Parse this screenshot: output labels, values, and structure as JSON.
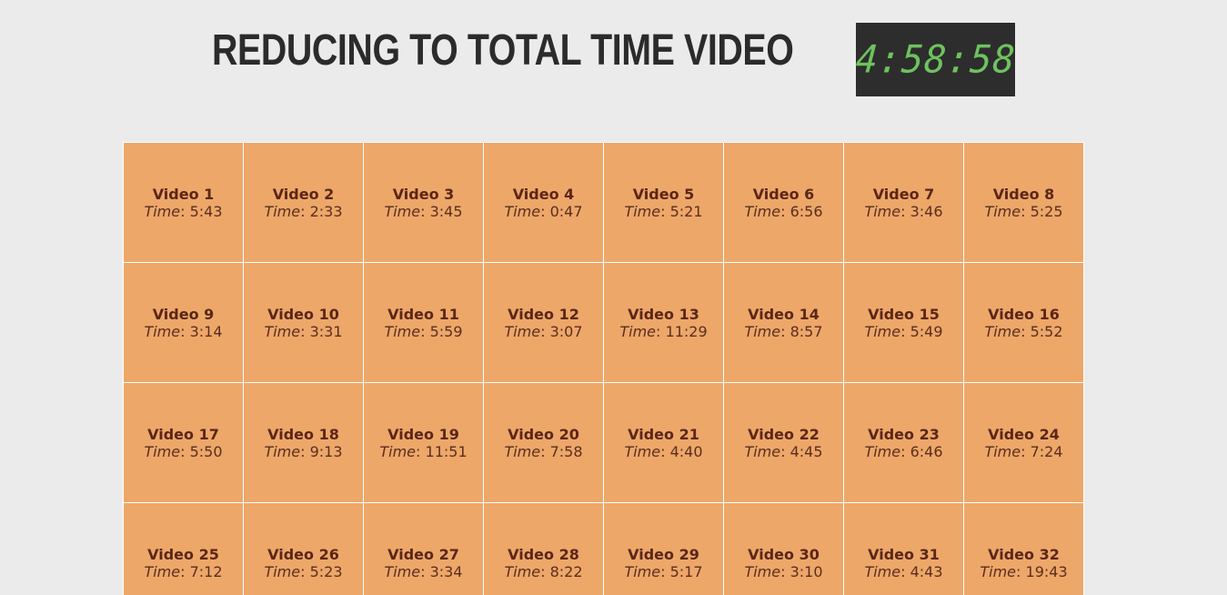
{
  "header": {
    "title": "REDUCING TO TOTAL TIME VIDEO",
    "total_time": "4:58:58"
  },
  "time_label": "Time",
  "videos": [
    {
      "name": "Video 1",
      "time": "5:43"
    },
    {
      "name": "Video 2",
      "time": "2:33"
    },
    {
      "name": "Video 3",
      "time": "3:45"
    },
    {
      "name": "Video 4",
      "time": "0:47"
    },
    {
      "name": "Video 5",
      "time": "5:21"
    },
    {
      "name": "Video 6",
      "time": "6:56"
    },
    {
      "name": "Video 7",
      "time": "3:46"
    },
    {
      "name": "Video 8",
      "time": "5:25"
    },
    {
      "name": "Video 9",
      "time": "3:14"
    },
    {
      "name": "Video 10",
      "time": "3:31"
    },
    {
      "name": "Video 11",
      "time": "5:59"
    },
    {
      "name": "Video 12",
      "time": "3:07"
    },
    {
      "name": "Video 13",
      "time": "11:29"
    },
    {
      "name": "Video 14",
      "time": "8:57"
    },
    {
      "name": "Video 15",
      "time": "5:49"
    },
    {
      "name": "Video 16",
      "time": "5:52"
    },
    {
      "name": "Video 17",
      "time": "5:50"
    },
    {
      "name": "Video 18",
      "time": "9:13"
    },
    {
      "name": "Video 19",
      "time": "11:51"
    },
    {
      "name": "Video 20",
      "time": "7:58"
    },
    {
      "name": "Video 21",
      "time": "4:40"
    },
    {
      "name": "Video 22",
      "time": "4:45"
    },
    {
      "name": "Video 23",
      "time": "6:46"
    },
    {
      "name": "Video 24",
      "time": "7:24"
    },
    {
      "name": "Video 25",
      "time": "7:12"
    },
    {
      "name": "Video 26",
      "time": "5:23"
    },
    {
      "name": "Video 27",
      "time": "3:34"
    },
    {
      "name": "Video 28",
      "time": "8:22"
    },
    {
      "name": "Video 29",
      "time": "5:17"
    },
    {
      "name": "Video 30",
      "time": "3:10"
    },
    {
      "name": "Video 31",
      "time": "4:43"
    },
    {
      "name": "Video 32",
      "time": "19:43"
    }
  ],
  "colors": {
    "background": "#ebebeb",
    "tile": "#eda769",
    "tile_text": "#5a2617",
    "clock_bg": "#2d2d2d",
    "clock_digits": "#6ec25f",
    "title": "#2b2b2b"
  }
}
